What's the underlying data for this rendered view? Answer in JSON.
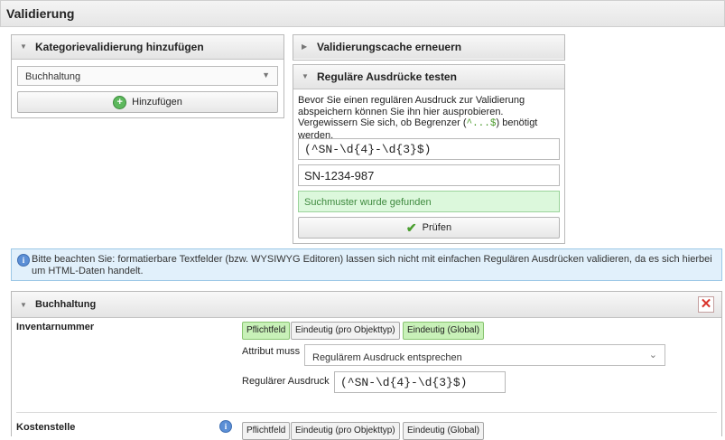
{
  "page": {
    "title": "Validierung"
  },
  "category_panel": {
    "title": "Kategorievalidierung hinzufügen",
    "select_value": "Buchhaltung",
    "add_button": "Hinzufügen"
  },
  "cache_panel": {
    "title": "Validierungscache erneuern"
  },
  "regex_panel": {
    "title": "Reguläre Ausdrücke testen",
    "description_1": "Bevor Sie einen regulären Ausdruck zur Validierung abspeichern können Sie ihn hier ausprobieren. Vergewissern Sie sich, ob Begrenzer (",
    "description_code": "^...$",
    "description_2": ") benötigt werden.",
    "pattern_value": "(^SN-\\d{4}-\\d{3}$)",
    "test_value": "SN-1234-987",
    "result_text": "Suchmuster wurde gefunden",
    "check_button": "Prüfen"
  },
  "notice": {
    "text": "Bitte beachten Sie: formatierbare Textfelder (bzw. WYSIWYG Editoren) lassen sich nicht mit einfachen Regulären Ausdrücken validieren, da es sich hierbei um HTML-Daten handelt."
  },
  "buchhaltung_panel": {
    "title": "Buchhaltung",
    "fields": [
      {
        "name": "Inventarnummer",
        "tags": [
          {
            "label": "Pflichtfeld",
            "active": true
          },
          {
            "label": "Eindeutig (pro Objekttyp)",
            "active": false
          },
          {
            "label": "Eindeutig (Global)",
            "active": true
          }
        ],
        "attribute_label": "Attribut muss",
        "attribute_value": "Regulärem Ausdruck entsprechen",
        "regex_label": "Regulärer Ausdruck",
        "regex_value": "(^SN-\\d{4}-\\d{3}$)"
      },
      {
        "name": "Kostenstelle",
        "tags": [
          {
            "label": "Pflichtfeld",
            "active": false
          },
          {
            "label": "Eindeutig (pro Objekttyp)",
            "active": false
          },
          {
            "label": "Eindeutig (Global)",
            "active": false
          }
        ]
      }
    ]
  },
  "colors": {
    "active_tag": "#c8f1b8",
    "success_bg": "#dcf8dc",
    "info_bg": "#e1f0fb",
    "close_red": "#d9342b"
  },
  "icons": {
    "panel_toggle": "triangle-down-icon",
    "panel_collapsed": "triangle-right-icon",
    "add": "plus-circle-icon",
    "check": "check-icon",
    "info": "info-icon",
    "close": "close-icon"
  }
}
